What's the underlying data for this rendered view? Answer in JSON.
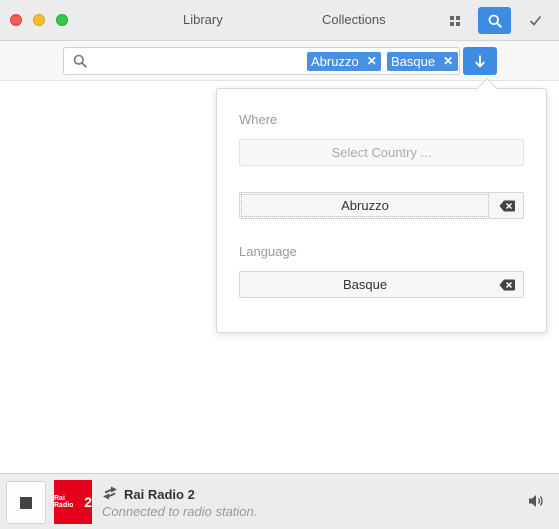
{
  "titlebar": {
    "nav_library": "Library",
    "nav_collections": "Collections",
    "icons": [
      "grid-icon",
      "search-icon",
      "checkmark-icon"
    ],
    "accent_color": "#3d8be3"
  },
  "search": {
    "value": "",
    "tags": [
      {
        "label": "Abruzzo"
      },
      {
        "label": "Basque"
      }
    ],
    "remove_glyph": "✕"
  },
  "filters": {
    "where_label": "Where",
    "country_placeholder": "Select Country ...",
    "region_value": "Abruzzo",
    "language_label": "Language",
    "language_value": "Basque"
  },
  "player": {
    "station_name": "Rai Radio 2",
    "status": "Connected to radio station.",
    "logo_text_small": "Rai Radio",
    "logo_text_big": "2"
  }
}
